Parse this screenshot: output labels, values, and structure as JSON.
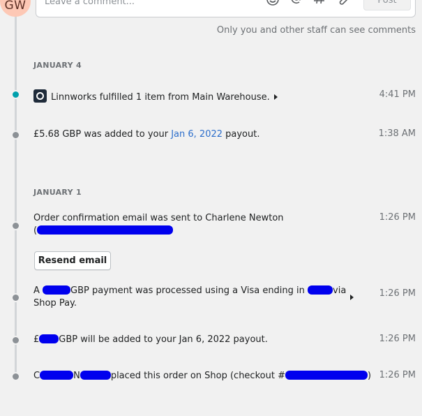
{
  "avatar": {
    "initials": "GW"
  },
  "comment": {
    "placeholder": "Leave a comment...",
    "post_label": "Post",
    "staff_note": "Only you and other staff can see comments"
  },
  "groups": [
    {
      "date": "JANUARY 4",
      "events": [
        {
          "text": "Linnworks fulfilled 1 item from Main Warehouse.",
          "time": "4:41 PM"
        },
        {
          "prefix": "£5.68 GBP was added to your ",
          "link": "Jan 6, 2022",
          "suffix": " payout.",
          "time": "1:38 AM"
        }
      ]
    },
    {
      "date": "JANUARY 1",
      "events": [
        {
          "text": "Order confirmation email was sent to Charlene Newton",
          "line2": "(",
          "time": "1:26 PM",
          "button": "Resend email"
        },
        {
          "part1": "A ",
          "part2": "GBP payment was processed using a Visa ending in ",
          "part3": "via",
          "line2": "Shop Pay.",
          "time": "1:26 PM"
        },
        {
          "part1": "£",
          "part2": "GBP will be added to your Jan 6, 2022 payout.",
          "time": "1:26 PM"
        },
        {
          "part1": "C",
          "part2": "N",
          "part3": "placed this order on Shop (checkout #",
          "part4": ")",
          "time": "1:26 PM"
        }
      ]
    }
  ],
  "colors": {
    "accent_dot": "#00a0ac",
    "link": "#2c6ecb",
    "redaction": "#0000ee"
  }
}
